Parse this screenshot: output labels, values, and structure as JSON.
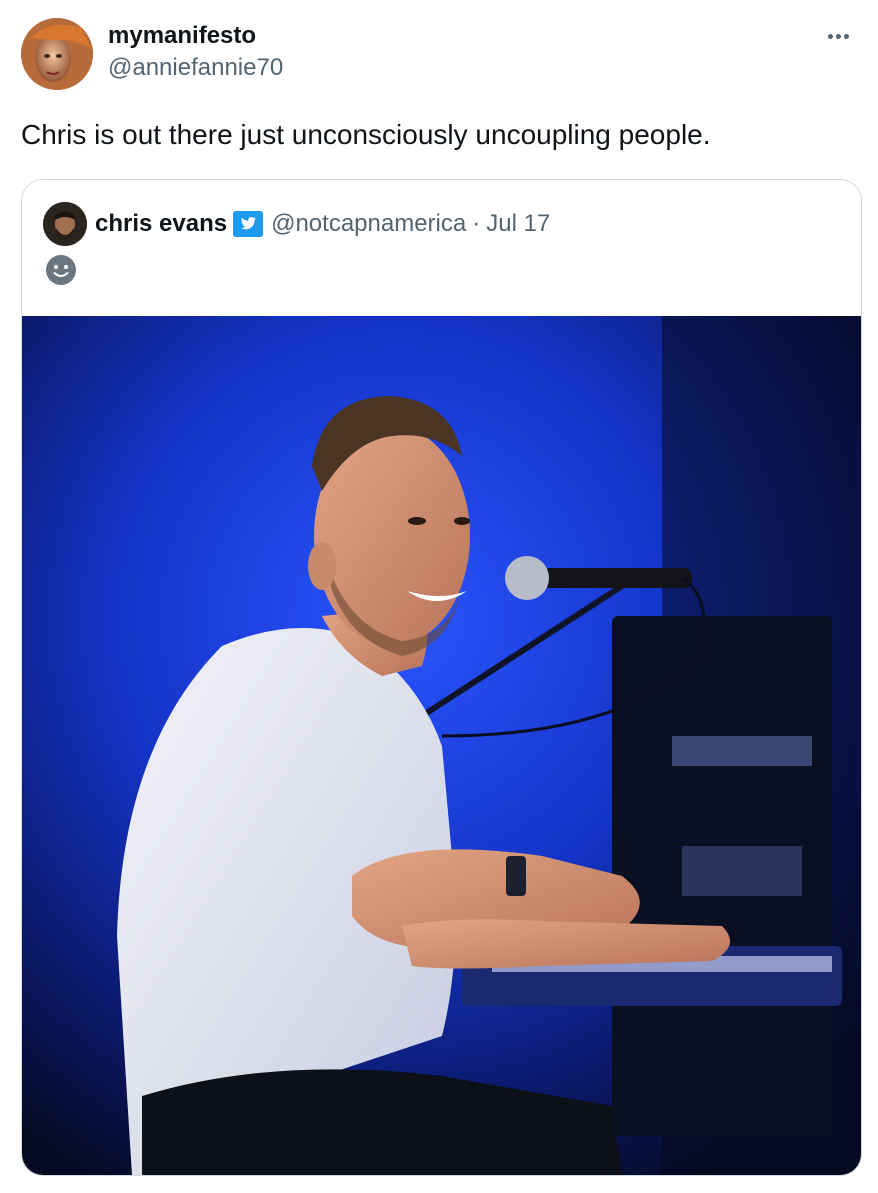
{
  "tweet": {
    "author": {
      "display_name": "mymanifesto",
      "handle": "@anniefannie70",
      "avatar_icon": "avatar-icon"
    },
    "text": "Chris is out there just unconsciously uncoupling people.",
    "more_icon": "more-options-icon"
  },
  "quoted_tweet": {
    "author": {
      "display_name": "chris evans",
      "handle": "@notcapnamerica",
      "badge_icon": "twitter-bird-icon",
      "badge_color": "#1d9bf0"
    },
    "separator": "·",
    "date": "Jul 17",
    "emoji_icon": "slightly-smiling-face-icon",
    "media": {
      "type": "photo",
      "description_icon": "photo-icon"
    }
  },
  "colors": {
    "text_primary": "#0f1419",
    "text_secondary": "#536471",
    "border": "#cfd9de",
    "stage_blue": "#1a3cd6"
  }
}
